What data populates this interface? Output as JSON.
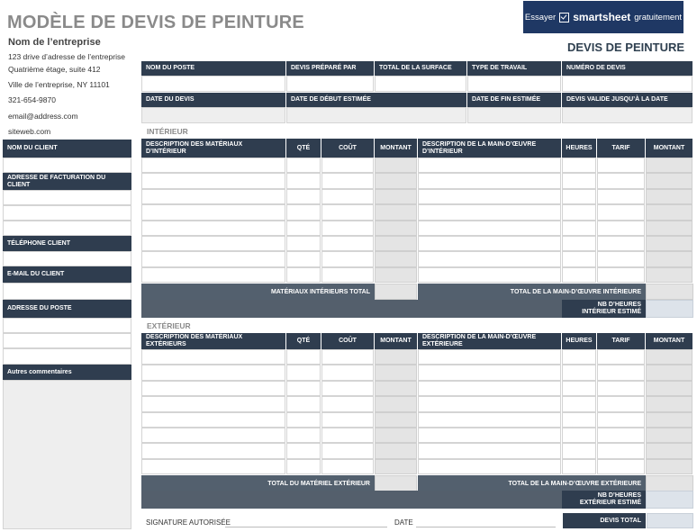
{
  "title": "MODÈLE DE DEVIS DE PEINTURE",
  "company": {
    "name": "Nom de l’entreprise",
    "address1": "123 drive d’adresse de l’entreprise",
    "address2": "Quatrième étage, suite 412",
    "city": "Ville de l’entreprise, NY 11101",
    "phone": "321-654-9870",
    "email": "email@address.com",
    "website": "siteweb.com"
  },
  "banner": {
    "try_label": "Essayer",
    "brand": "smartsheet",
    "free_label": "gratuitement"
  },
  "doc_heading": "DEVIS DE PEINTURE",
  "client_labels": {
    "name": "NOM DU CLIENT",
    "billing": "ADRESSE DE FACTURATION DU CLIENT",
    "phone": "TÉLÉPHONE CLIENT",
    "email": "E-MAIL DU CLIENT",
    "job_address": "ADRESSE DU POSTE",
    "comments": "Autres commentaires"
  },
  "job_row1": [
    "NOM DU POSTE",
    "DEVIS PRÉPARÉ PAR",
    "TOTAL DE LA SURFACE",
    "TYPE DE TRAVAIL",
    "NUMÉRO DE DEVIS"
  ],
  "job_row2": [
    "DATE DU DEVIS",
    "DATE DE DÉBUT ESTIMÉE",
    "DATE DE FIN ESTIMÉE",
    "DEVIS VALIDE JUSQU’À LA DATE"
  ],
  "interior": {
    "section": "INTÉRIEUR",
    "headers": [
      "DESCRIPTION DES MATÉRIAUX D’INTÉRIEUR",
      "QTÉ",
      "COÛT",
      "MONTANT",
      "DESCRIPTION DE LA MAIN-D’ŒUVRE D’INTÉRIEUR",
      "HEURES",
      "TARIF",
      "MONTANT"
    ],
    "materials_total": "MATÉRIAUX INTÉRIEURS TOTAL",
    "labor_total": "TOTAL DE LA MAIN-D’ŒUVRE INTÉRIEURE",
    "hours_estimated": "NB D’HEURES INTÉRIEUR ESTIMÉ"
  },
  "exterior": {
    "section": "EXTÉRIEUR",
    "headers": [
      "DESCRIPTION DES MATÉRIAUX EXTÉRIEURS",
      "QTÉ",
      "COÛT",
      "MONTANT",
      "DESCRIPTION DE LA MAIN-D’ŒUVRE EXTÉRIEURE",
      "HEURES",
      "TARIF",
      "MONTANT"
    ],
    "materials_total": "TOTAL DU MATÉRIEL EXTÉRIEUR",
    "labor_total": "TOTAL DE LA MAIN-D’ŒUVRE EXTÉRIEURE",
    "hours_estimated": "NB D’HEURES EXTÉRIEUR ESTIMÉ"
  },
  "footer": {
    "signature": "SIGNATURE AUTORISÉE",
    "date": "DATE",
    "quote_total": "DEVIS TOTAL"
  }
}
